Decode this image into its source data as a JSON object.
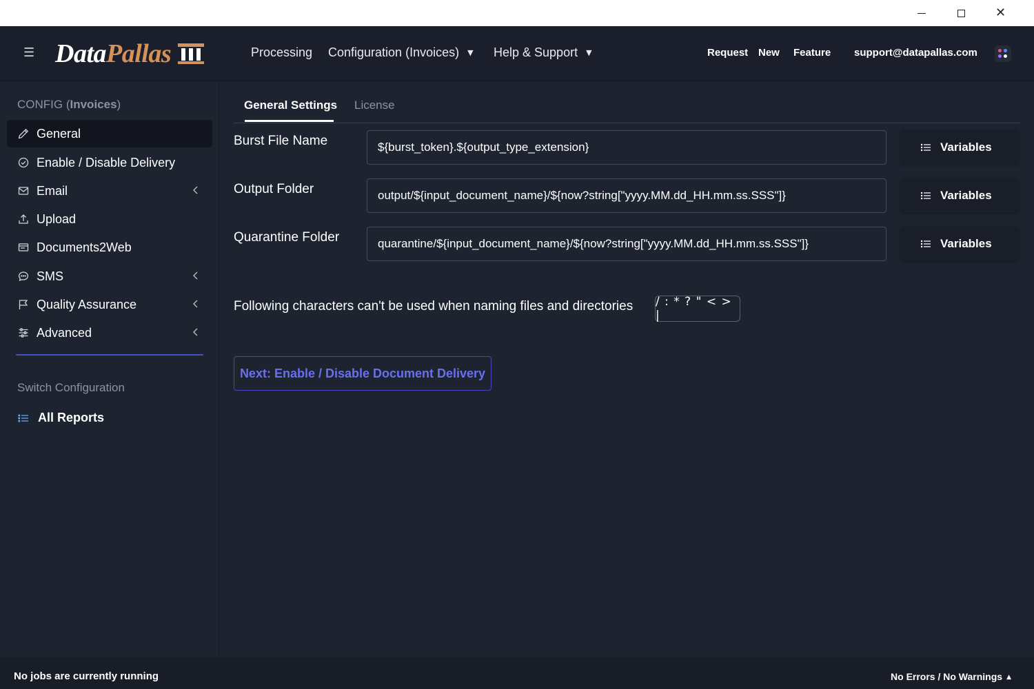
{
  "app": {
    "logo_part1": "Data",
    "logo_part2": "Pallas",
    "colors": {
      "accent": "#4a4fc4",
      "logo_orange": "#d6915a",
      "bg": "#1e2330",
      "header_bg": "#1a1f2b"
    }
  },
  "window": {
    "controls": [
      "minimize-icon",
      "maximize-icon",
      "close-icon"
    ],
    "close_glyph": "✕"
  },
  "header": {
    "menu_icon": "☰",
    "nav": [
      {
        "label": "Processing"
      },
      {
        "label": "Configuration (Invoices)",
        "caret": "▼"
      },
      {
        "label": "Help & Support",
        "caret": "▼"
      }
    ],
    "links": {
      "request": "Request",
      "new": "New",
      "feature": "Feature",
      "email": "support@datapallas.com"
    }
  },
  "sidebar": {
    "title_prefix": "CONFIG (",
    "title_bold": "Invoices",
    "title_suffix": ")",
    "items": [
      {
        "label": "General",
        "icon": "pencil-icon",
        "active": true
      },
      {
        "label": "Enable / Disable Delivery",
        "icon": "check-circle-icon"
      },
      {
        "label": "Email",
        "icon": "envelope-icon",
        "expandable": true
      },
      {
        "label": "Upload",
        "icon": "upload-icon"
      },
      {
        "label": "Documents2Web",
        "icon": "browser-icon"
      },
      {
        "label": "SMS",
        "icon": "chat-icon",
        "expandable": true
      },
      {
        "label": "Quality Assurance",
        "icon": "flag-icon",
        "expandable": true
      },
      {
        "label": "Advanced",
        "icon": "sliders-icon",
        "expandable": true
      }
    ],
    "section_title": "Switch Configuration",
    "all_reports": "All Reports"
  },
  "main": {
    "tabs": [
      {
        "label": "General Settings",
        "active": true
      },
      {
        "label": "License",
        "active": false
      }
    ],
    "fields": [
      {
        "label": "Burst File Name",
        "value": "${burst_token}.${output_type_extension}",
        "button": "Variables"
      },
      {
        "label": "Output Folder",
        "value": "output/${input_document_name}/${now?string[\"yyyy.MM.dd_HH.mm.ss.SSS\"]}",
        "button": "Variables"
      },
      {
        "label": "Quarantine Folder",
        "value": "quarantine/${input_document_name}/${now?string[\"yyyy.MM.dd_HH.mm.ss.SSS\"]}",
        "button": "Variables"
      }
    ],
    "note": "Following characters can't be used when naming files and directories",
    "forbidden_chars": "/ : * ? \" < > |",
    "next_button": "Next: Enable / Disable Document Delivery"
  },
  "status": {
    "left": "No jobs are currently running",
    "right": "No Errors / No Warnings",
    "right_caret": "▲"
  }
}
